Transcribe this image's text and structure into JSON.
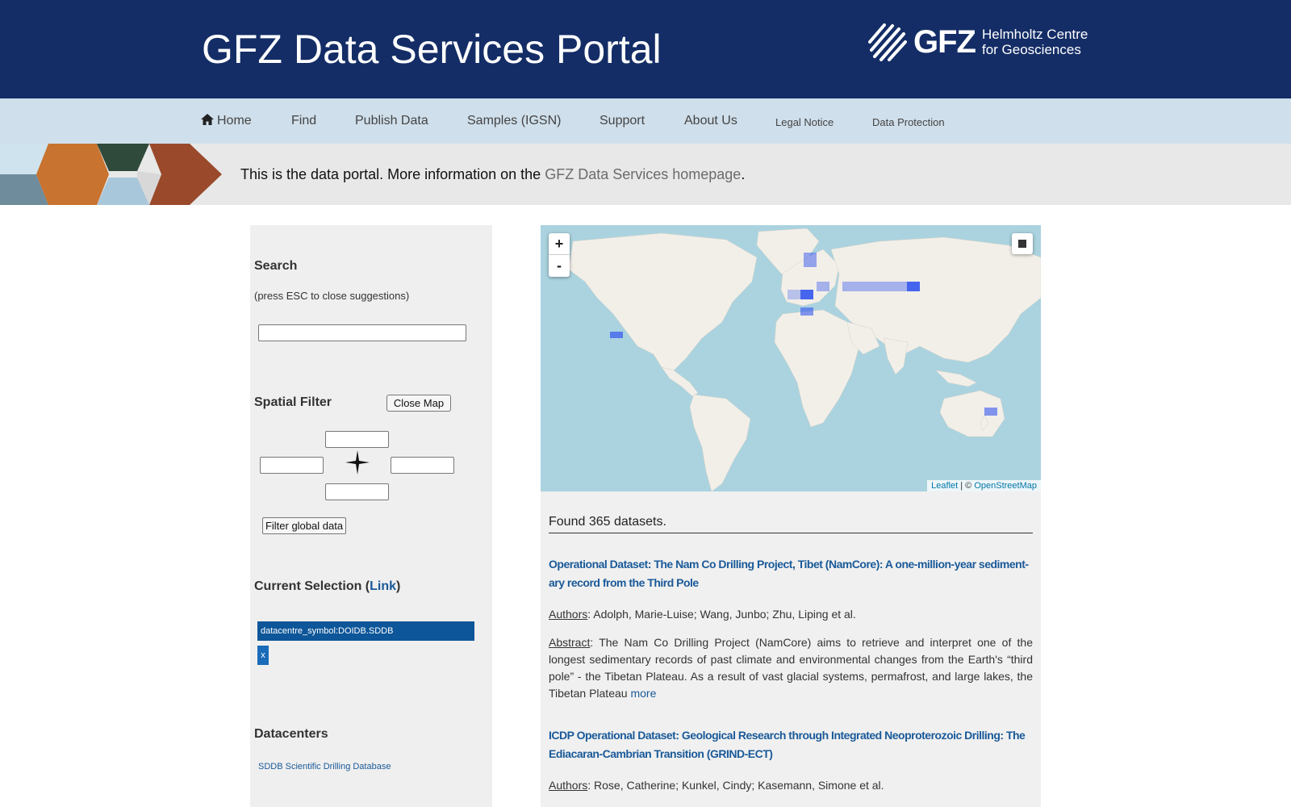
{
  "header": {
    "title": "GFZ Data Services Portal",
    "logo_text": "GFZ",
    "logo_sub_line1": "Helmholtz Centre",
    "logo_sub_line2": "for Geosciences"
  },
  "nav": {
    "home": "Home",
    "find": "Find",
    "publish": "Publish Data",
    "samples": "Samples (IGSN)",
    "support": "Support",
    "about": "About Us",
    "legal": "Legal Notice",
    "privacy": "Data Protection"
  },
  "banner": {
    "text_before": "This is the data portal. More information on the ",
    "link": "GFZ Data Services homepage",
    "text_after": "."
  },
  "left": {
    "search_heading": "Search",
    "search_hint": "(press ESC to close suggestions)",
    "search_value": "",
    "spatial_heading": "Spatial Filter",
    "close_map": "Close Map",
    "filter_global": "Filter global data",
    "current_selection_prefix": "Current Selection (",
    "current_selection_link": "Link",
    "current_selection_suffix": ")",
    "selection_tag": "datacentre_symbol:DOIDB.SDDB",
    "remove_tag": "x",
    "datacenters_heading": "Datacenters",
    "datacenter_item": "SDDB Scientific Drilling Database"
  },
  "map": {
    "zoom_in": "+",
    "zoom_out": "-",
    "attrib_leaflet": "Leaflet",
    "attrib_sep": " | © ",
    "attrib_osm": "OpenStreetMap",
    "ocean_color": "#aad3df",
    "land_color": "#f2efe9",
    "marker_color": "#3355ee"
  },
  "results": {
    "found": "Found 365 datasets.",
    "datasets": [
      {
        "title": "Operational Dataset: The Nam Co Drilling Project, Tibet (NamCore): A one-million-year sediment-ary record from the Third Pole",
        "authors_label": "Authors",
        "authors": ": Adolph, Marie-Luise; Wang, Junbo; Zhu, Liping et al.",
        "abstract_label": "Abstract",
        "abstract": ": The Nam Co Drilling Project (NamCore) aims to retrieve and interpret one of the longest sedimentary records of past climate and environmental changes from the Earth's “third pole” - the Tibetan Plateau. As a result of vast glacial systems, permafrost, and large lakes, the Tibetan Plateau ",
        "more": "more"
      },
      {
        "title": "ICDP Operational Dataset: Geological Research through Integrated Neoproterozoic Drilling: The Ediacaran-Cambrian Transition (GRIND-ECT)",
        "authors_label": "Authors",
        "authors": ": Rose, Catherine; Kunkel, Cindy; Kasemann, Simone et al."
      }
    ]
  }
}
